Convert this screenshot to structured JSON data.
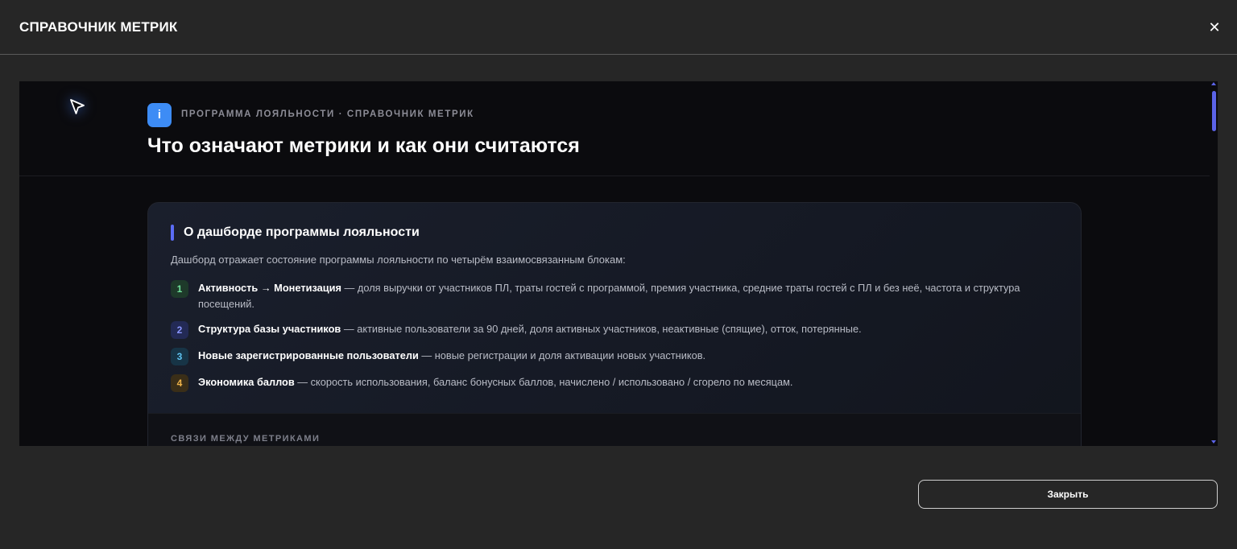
{
  "modal": {
    "title": "СПРАВОЧНИК МЕТРИК",
    "close_icon": "close-icon",
    "close_symbol": "✕",
    "close_button_label": "Закрыть"
  },
  "content": {
    "badge_icon": "info-icon",
    "badge_text": "i",
    "eyebrow": "ПРОГРАММА ЛОЯЛЬНОСТИ · СПРАВОЧНИК МЕТРИК",
    "heading": "Что означают метрики и как они считаются",
    "card": {
      "title": "О дашборде программы лояльности",
      "intro": "Дашборд отражает состояние программы лояльности по четырём взаимосвязанным блокам:",
      "items": [
        {
          "num": "1",
          "bold": "Активность → Монетизация",
          "text": " — доля выручки от участников ПЛ, траты гостей с программой, премия участника, средние траты гостей с ПЛ и без неё, частота и структура посещений."
        },
        {
          "num": "2",
          "bold": "Структура базы участников",
          "text": " — активные пользователи за 90 дней, доля активных участников, неактивные (спящие), отток, потерянные."
        },
        {
          "num": "3",
          "bold": "Новые зарегистрированные пользователи",
          "text": " — новые регистрации и доля активации новых участников."
        },
        {
          "num": "4",
          "bold": "Экономика баллов",
          "text": " — скорость использования, баланс бонусных баллов, начислено / использовано / сгорело по месяцам."
        }
      ],
      "footer_label": "СВЯЗИ МЕЖДУ МЕТРИКАМИ"
    }
  },
  "colors": {
    "accent": "#5b6cf5",
    "badge": "#3d8cf5",
    "num1": "#6fe09a",
    "num2": "#8a96ff",
    "num3": "#5fc3f0",
    "num4": "#f0b44a"
  }
}
